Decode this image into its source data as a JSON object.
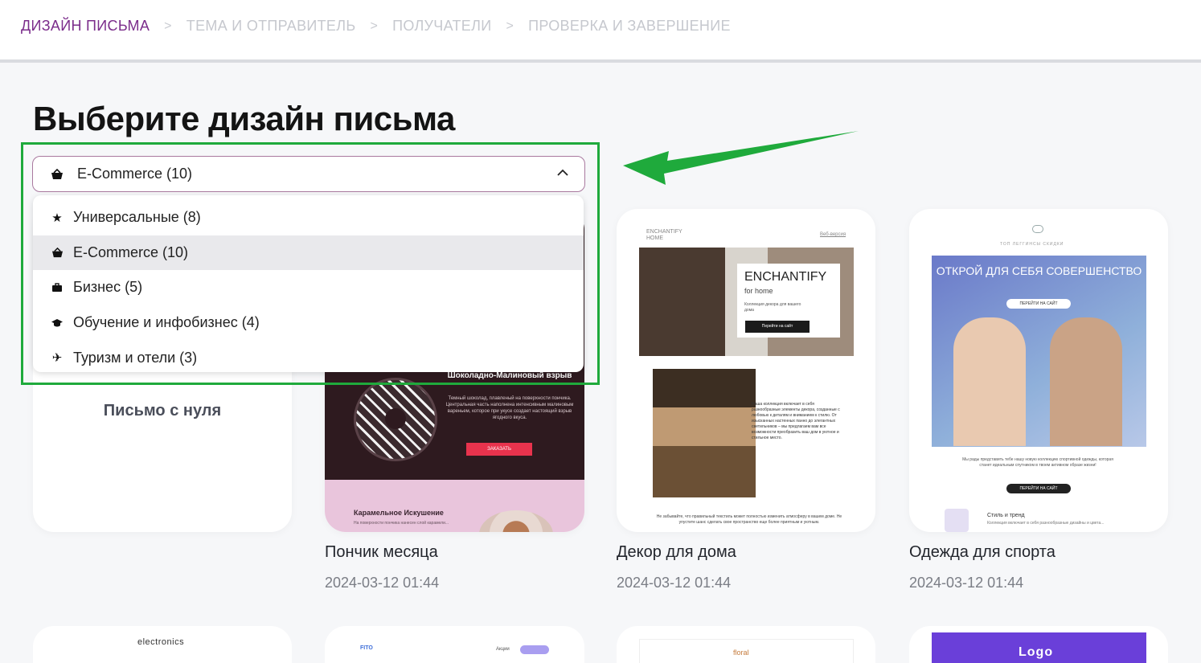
{
  "steps": [
    {
      "label": "Дизайн письма",
      "active": true
    },
    {
      "label": "Тема и отправитель",
      "active": false
    },
    {
      "label": "Получатели",
      "active": false
    },
    {
      "label": "Проверка и завершение",
      "active": false
    }
  ],
  "step_separator": ">",
  "page_title": "Выберите дизайн письма",
  "category_select": {
    "icon": "basket-icon",
    "value": "E-Commerce (10)",
    "expanded": true
  },
  "category_options": [
    {
      "icon": "star-icon",
      "label": "Универсальные (8)",
      "selected": false
    },
    {
      "icon": "basket-icon",
      "label": "E-Commerce (10)",
      "selected": true
    },
    {
      "icon": "briefcase-icon",
      "label": "Бизнес (5)",
      "selected": false
    },
    {
      "icon": "graduation-cap-icon",
      "label": "Обучение и инфобизнес (4)",
      "selected": false
    },
    {
      "icon": "airplane-icon",
      "label": "Туризм и отели (3)",
      "selected": false
    }
  ],
  "blank_template": {
    "label": "Письмо с нуля"
  },
  "templates": [
    {
      "title": "Пончик месяца",
      "date": "2024-03-12 01:44",
      "preview": {
        "heading": "Шоколадно-Малиновый взрыв",
        "body": "Темный шоколад, плавленый на поверхности пончика. Центральная часть наполнена интенсивным малиновым вареньем, которое при укусе создает настоящий взрыв ягодного вкуса.",
        "button": "ЗАКАЗАТЬ",
        "second_heading": "Карамельное Искушение",
        "second_body": "На поверхности пончика нанесен слой карамели..."
      }
    },
    {
      "title": "Декор для дома",
      "date": "2024-03-12 01:44",
      "preview": {
        "brand": "ENCHANTIFY",
        "brand_sub": "HOME",
        "link": "Веб-версия",
        "hero_title": "ENCHANTIFY",
        "hero_subtitle": "for home",
        "hero_text": "Коллекция декора для вашего дома",
        "hero_button": "Перейти на сайт",
        "body": "Наша коллекция включает в себя разнообразные элементы декора, созданные с любовью к деталям и вниманием к стилю. От изысканных настенных панно до элегантных светильников – мы предлагаем вам все возможности преобразить ваш дом в уютное и стильное место.",
        "footer": "Не забывайте, что правильный текстиль может полностью изменить атмосферу в вашем доме. Не упустите шанс сделать свое пространство еще более приятным и уютным."
      }
    },
    {
      "title": "Одежда для спорта",
      "date": "2024-03-12 01:44",
      "preview": {
        "nav": "ТОП    ЛЕГГИНСЫ    СКИДКИ",
        "hero_title": "ОТКРОЙ ДЛЯ СЕБЯ СОВЕРШЕНСТВО",
        "hero_button": "ПЕРЕЙТИ НА САЙТ",
        "body": "Мы рады представить тебе нашу новую коллекцию спортивной одежды, которая станет идеальным спутником в твоем активном образе жизни!",
        "button": "ПЕРЕЙТИ НА САЙТ",
        "sub_heading": "Стиль и тренд",
        "sub_body": "Коллекция включает в себя разнообразные дизайны и цвета..."
      }
    }
  ],
  "bottom_row": [
    {
      "text": "electronics"
    },
    {
      "logo": "FITO",
      "nav": "Акции"
    },
    {
      "logo": "floral"
    },
    {
      "logo": "Logo"
    }
  ],
  "colors": {
    "accent": "#7b2d8b",
    "highlight_box": "#1faa3c",
    "arrow": "#1faa3c"
  }
}
